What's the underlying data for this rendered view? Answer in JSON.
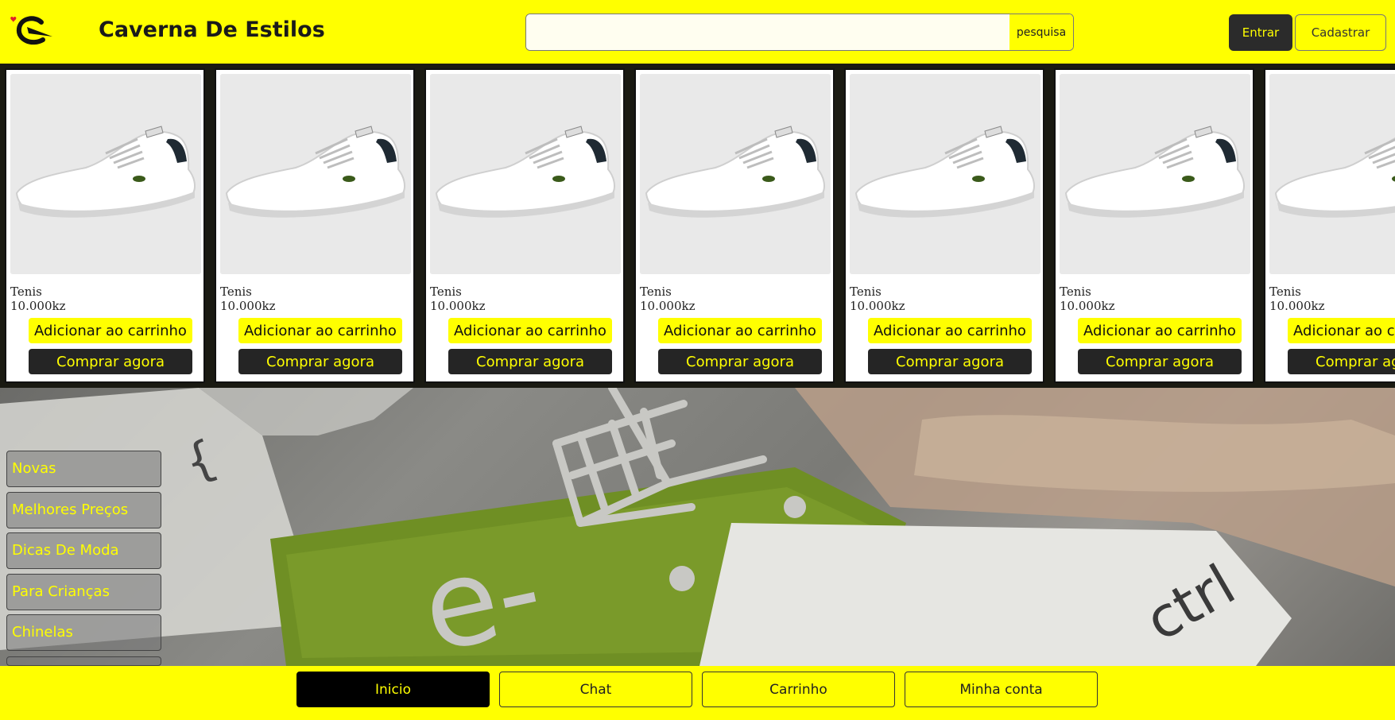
{
  "header": {
    "title": "Caverna De Estilos",
    "search_placeholder": "",
    "search_button": "pesquisa",
    "login_button": "Entrar",
    "register_button": "Cadastrar"
  },
  "products": [
    {
      "name": "Tenis",
      "price": "10.000kz",
      "add_label": "Adicionar ao carrinho",
      "buy_label": "Comprar agora"
    },
    {
      "name": "Tenis",
      "price": "10.000kz",
      "add_label": "Adicionar ao carrinho",
      "buy_label": "Comprar agora"
    },
    {
      "name": "Tenis",
      "price": "10.000kz",
      "add_label": "Adicionar ao carrinho",
      "buy_label": "Comprar agora"
    },
    {
      "name": "Tenis",
      "price": "10.000kz",
      "add_label": "Adicionar ao carrinho",
      "buy_label": "Comprar agora"
    },
    {
      "name": "Tenis",
      "price": "10.000kz",
      "add_label": "Adicionar ao carrinho",
      "buy_label": "Comprar agora"
    },
    {
      "name": "Tenis",
      "price": "10.000kz",
      "add_label": "Adicionar ao carrinho",
      "buy_label": "Comprar agora"
    },
    {
      "name": "Tenis",
      "price": "10.000kz",
      "add_label": "Adicionar ao carrinho",
      "buy_label": "Comprar agora"
    }
  ],
  "hero": {
    "key_text": "e-",
    "ctrl_text": "ctrl"
  },
  "sidebar": {
    "categories": [
      "Novas",
      "Melhores Preços",
      "Dicas De Moda",
      "Para Crianças",
      "Chinelas"
    ]
  },
  "bottom_nav": {
    "items": [
      "Inicio",
      "Chat",
      "Carrinho",
      "Minha conta"
    ],
    "active": "Inicio"
  },
  "colors": {
    "accent": "#ffff00",
    "dark": "#252525",
    "green_key": "#7a9a2a"
  }
}
